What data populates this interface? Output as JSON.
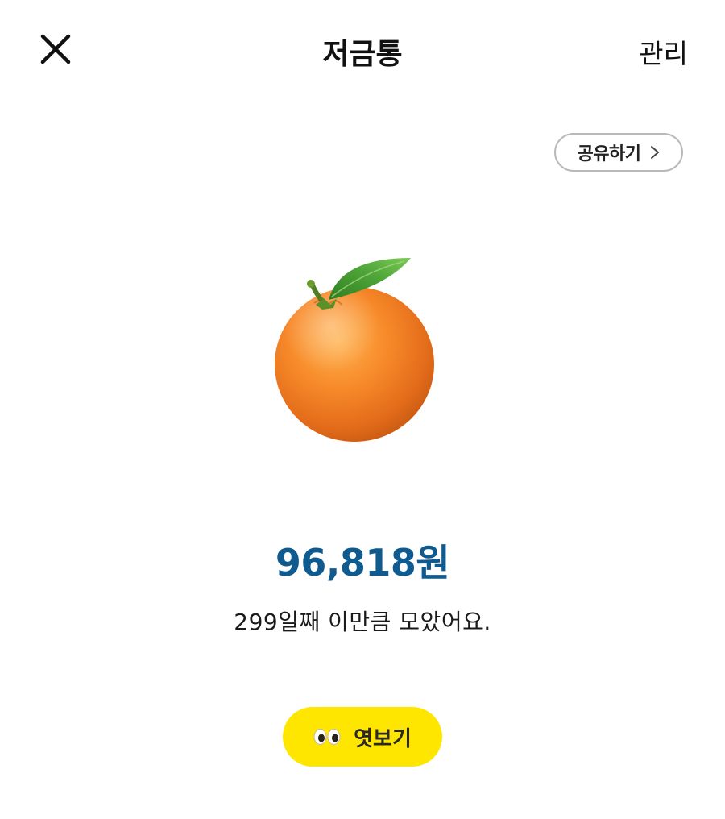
{
  "header": {
    "title": "저금통",
    "close_icon": "close-icon",
    "manage_label": "관리"
  },
  "share": {
    "label": "공유하기",
    "icon": "chevron-right-icon"
  },
  "savings": {
    "illustration": "orange-icon",
    "amount": "96,818",
    "currency": "원",
    "message": "299일째 이만큼 모았어요."
  },
  "peek": {
    "icon": "eyes-icon",
    "label": "엿보기"
  },
  "colors": {
    "amount": "#0f5a8e",
    "peek_button": "#ffe600",
    "pill_border": "#b9b9b9"
  }
}
